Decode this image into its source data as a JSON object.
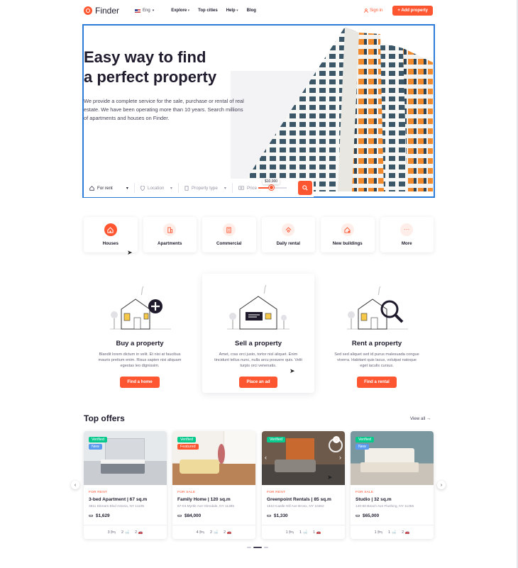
{
  "nav": {
    "logo_text": "Finder",
    "lang": "Eng",
    "menu": [
      "Explore",
      "Top cities",
      "Help",
      "Blog"
    ],
    "sign_in": "Sign in",
    "add_property": "+ Add property"
  },
  "hero": {
    "title_line1": "Easy way to find",
    "title_line2": "a perfect property",
    "subtitle": "We provide a complete service for the sale, purchase or rental of real estate. We have been operating more than 10 years. Search millions of apartments and houses on Finder."
  },
  "search": {
    "mode": "For rent",
    "location": "Location",
    "property_type": "Property type",
    "price_label": "Price",
    "price_value": "$10,000",
    "price_slider_level": 0.45
  },
  "categories": [
    "Houses",
    "Apartments",
    "Commercial",
    "Daily rental",
    "New buildings",
    "More"
  ],
  "services": [
    {
      "title": "Buy a property",
      "text": "Blandit lorem dictum in velit. Et nisi at faucibus mauris pretium enim. Risus sapien nisi aliquam egestas leo dignissim.",
      "button": "Find a home"
    },
    {
      "title": "Sell a property",
      "text": "Amet, cras orci justo, tortor nisl aliquet. Enim tincidunt tellus nunc, nulla arcu posuere quis. Velit turpis orci venenatis.",
      "button": "Place an ad"
    },
    {
      "title": "Rent a property",
      "text": "Sed sed aliquet sed id purus malesuada congue viverra. Habitant quis lacus, volutpat natoque eget iaculis cursus.",
      "button": "Find a rental"
    }
  ],
  "offers": {
    "title": "Top offers",
    "view_all": "View all",
    "cards": [
      {
        "badges": [
          "Verified",
          "New"
        ],
        "tag": "FOR RENT",
        "name": "3-bed Apartment | 67 sq.m",
        "address": "3811 Ditmars Blvd Astoria, NY 11105",
        "price": "$1,629",
        "beds": "3",
        "baths": "2",
        "cars": "2"
      },
      {
        "badges": [
          "Verified",
          "Featured"
        ],
        "tag": "FOR SALE",
        "name": "Family Home | 120 sq.m",
        "address": "67-04 Myrtle Ave Glendale, NY 11385",
        "price": "$84,000",
        "beds": "4",
        "baths": "2",
        "cars": "2"
      },
      {
        "badges": [
          "Verified"
        ],
        "tag": "FOR RENT",
        "name": "Greenpoint Rentals | 85 sq.m",
        "address": "1510 Castle Hill Ave Bronx, NY 10462",
        "price": "$1,330",
        "beds": "1",
        "baths": "1",
        "cars": "1"
      },
      {
        "badges": [
          "Verified",
          "New"
        ],
        "tag": "FOR SALE",
        "name": "Studio | 32 sq.m",
        "address": "140-60 Beach Ave Flushing, NY 11355",
        "price": "$65,000",
        "beds": "1",
        "baths": "1",
        "cars": "2"
      }
    ]
  },
  "colors": {
    "accent": "#fd5631",
    "verified": "#07c98b",
    "new": "#5a9bf0",
    "frame": "#2c7bd9"
  }
}
